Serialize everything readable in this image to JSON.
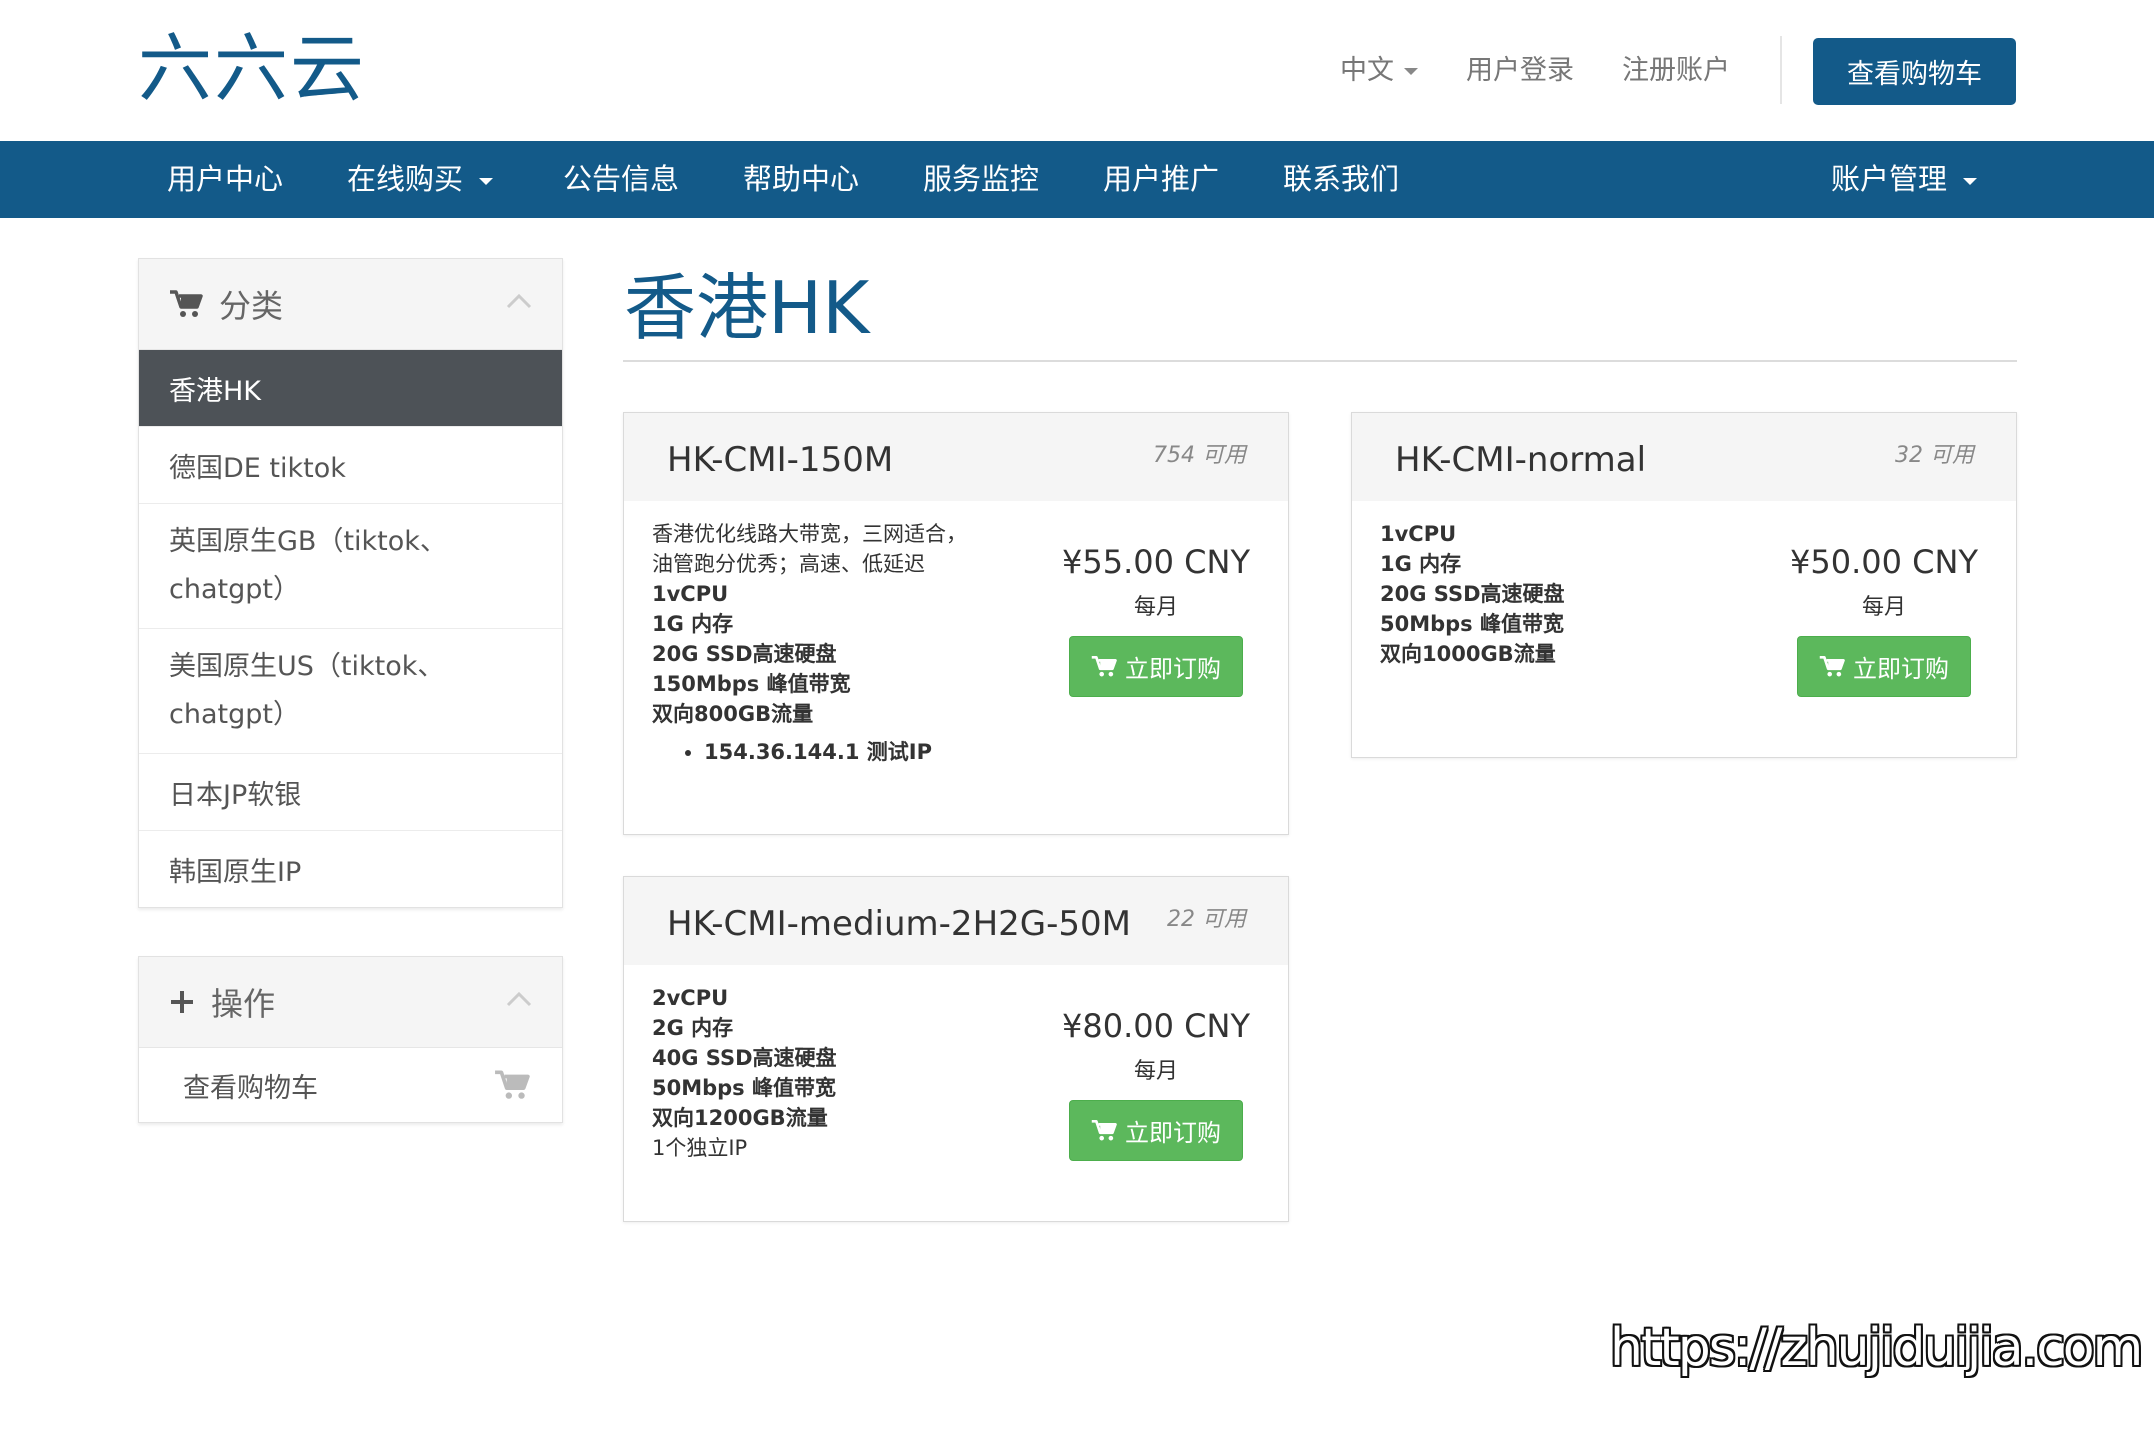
{
  "header": {
    "logo": "六六云",
    "language": "中文",
    "login": "用户登录",
    "register": "注册账户",
    "cart_button": "查看购物车"
  },
  "nav": {
    "items": [
      "用户中心",
      "在线购买",
      "公告信息",
      "帮助中心",
      "服务监控",
      "用户推广",
      "联系我们"
    ],
    "account": "账户管理"
  },
  "sidebar": {
    "categories_title": "分类",
    "categories": [
      {
        "line1": "香港HK"
      },
      {
        "line1": "德国DE tiktok"
      },
      {
        "line1": "英国原生GB（tiktok、",
        "line2": "chatgpt）"
      },
      {
        "line1": "美国原生US（tiktok、",
        "line2": "chatgpt）"
      },
      {
        "line1": "日本JP软银"
      },
      {
        "line1": "韩国原生IP"
      }
    ],
    "actions_title": "操作",
    "actions": [
      {
        "label": "查看购物车"
      }
    ]
  },
  "main": {
    "page_title": "香港HK",
    "products": [
      {
        "name": "HK-CMI-150M",
        "qty": "754 可用",
        "desc": [
          "香港优化线路大带宽，三网适合，",
          "油管跑分优秀；高速、低延迟",
          "1vCPU",
          "1G 内存",
          "20G SSD高速硬盘",
          "150Mbps 峰值带宽",
          "双向800GB流量"
        ],
        "bullet": "154.36.144.1 测试IP",
        "price": "¥55.00 CNY",
        "cycle": "每月",
        "order": "立即订购"
      },
      {
        "name": "HK-CMI-normal",
        "qty": "32 可用",
        "desc": [
          "1vCPU",
          "1G 内存",
          "20G SSD高速硬盘",
          "50Mbps 峰值带宽",
          "双向1000GB流量"
        ],
        "price": "¥50.00 CNY",
        "cycle": "每月",
        "order": "立即订购"
      },
      {
        "name": "HK-CMI-medium-2H2G-50M",
        "qty": "22 可用",
        "desc": [
          "2vCPU",
          "2G 内存",
          "40G SSD高速硬盘",
          "50Mbps 峰值带宽",
          "双向1200GB流量",
          "1个独立IP"
        ],
        "price": "¥80.00 CNY",
        "cycle": "每月",
        "order": "立即订购"
      }
    ]
  },
  "watermark": "https://zhujiduijia.com",
  "colors": {
    "brand": "#135a89",
    "order_button": "#5cb85c",
    "active_item": "#4d5257"
  }
}
